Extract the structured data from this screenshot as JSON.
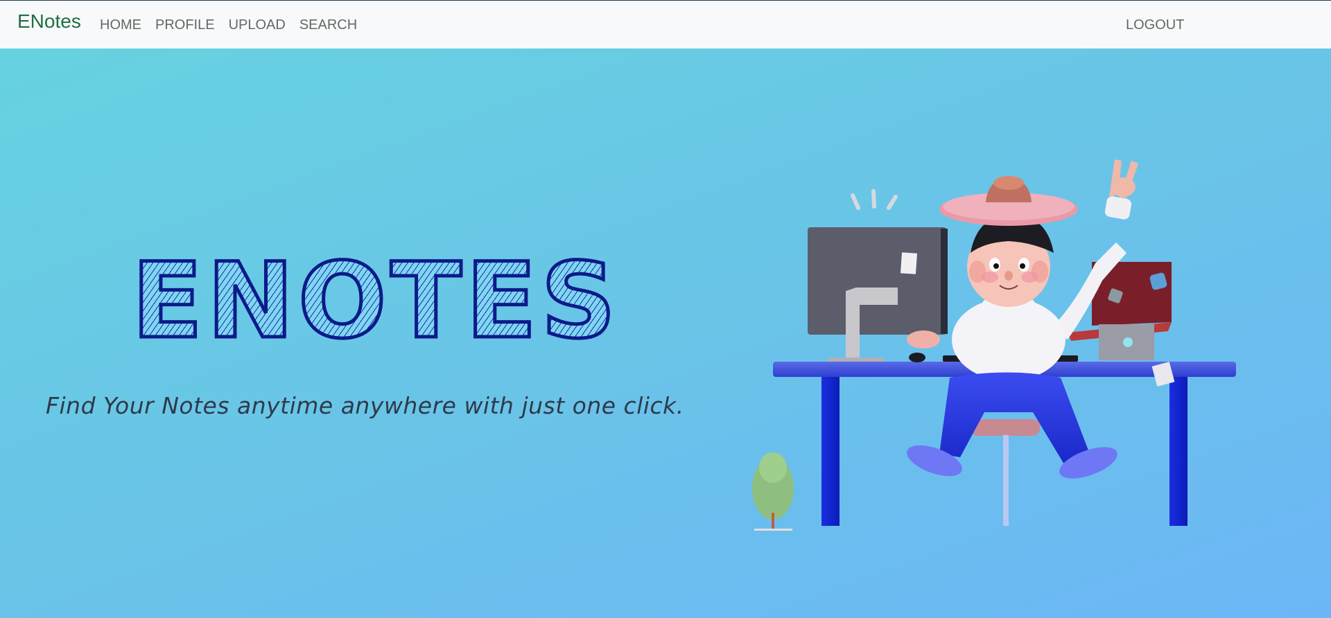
{
  "navbar": {
    "brand": "ENotes",
    "links": [
      {
        "label": "HOME"
      },
      {
        "label": "PROFILE"
      },
      {
        "label": "UPLOAD"
      },
      {
        "label": "SEARCH"
      }
    ],
    "logout_label": "LOGOUT"
  },
  "hero": {
    "title": "ENOTES",
    "tagline": "Find Your Notes anytime anywhere with just one click."
  },
  "colors": {
    "brand": "#1f6f42",
    "title_stroke": "#0c1a8a",
    "background_start": "#66d3df",
    "background_end": "#6cb6f6"
  },
  "illustration": {
    "icon": "person-at-desk-illustration"
  }
}
